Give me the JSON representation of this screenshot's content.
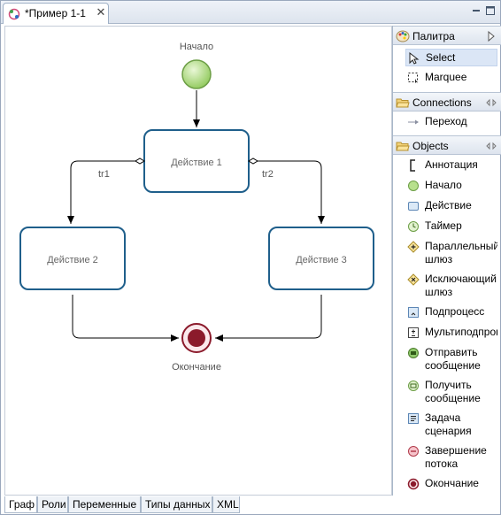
{
  "editor": {
    "tab_title": "*Пример 1-1",
    "tab_icon": "process-icon",
    "colors": {
      "node_border": "#1f5f8b",
      "node_fill": "#ffffff",
      "start_fill": "#b7e08d",
      "end_fill": "#8b1a2b"
    }
  },
  "diagram": {
    "start_label": "Начало",
    "end_label": "Окончание",
    "action1": "Действие 1",
    "action2": "Действие 2",
    "action3": "Действие 3",
    "tr1": "tr1",
    "tr2": "tr2"
  },
  "palette": {
    "title": "Палитра",
    "select": "Select",
    "marquee": "Marquee",
    "connections_title": "Connections",
    "transition": "Переход",
    "objects_title": "Objects",
    "objects": [
      {
        "label": "Аннотация",
        "icon": "annotation-icon"
      },
      {
        "label": "Начало",
        "icon": "start-event-icon"
      },
      {
        "label": "Действие",
        "icon": "task-icon"
      },
      {
        "label": "Таймер",
        "icon": "timer-icon"
      },
      {
        "label": "Параллельный шлюз",
        "icon": "parallel-gateway-icon"
      },
      {
        "label": "Исключающий шлюз",
        "icon": "exclusive-gateway-icon"
      },
      {
        "label": "Подпроцесс",
        "icon": "subprocess-icon"
      },
      {
        "label": "Мультиподпроцесс",
        "icon": "multi-subprocess-icon"
      },
      {
        "label": "Отправить сообщение",
        "icon": "send-message-icon"
      },
      {
        "label": "Получить сообщение",
        "icon": "receive-message-icon"
      },
      {
        "label": "Задача сценария",
        "icon": "script-task-icon"
      },
      {
        "label": "Завершение потока",
        "icon": "end-token-icon"
      },
      {
        "label": "Окончание",
        "icon": "end-event-icon"
      }
    ]
  },
  "bottom_tabs": [
    "Граф",
    "Роли",
    "Переменные",
    "Типы данных",
    "XML"
  ]
}
